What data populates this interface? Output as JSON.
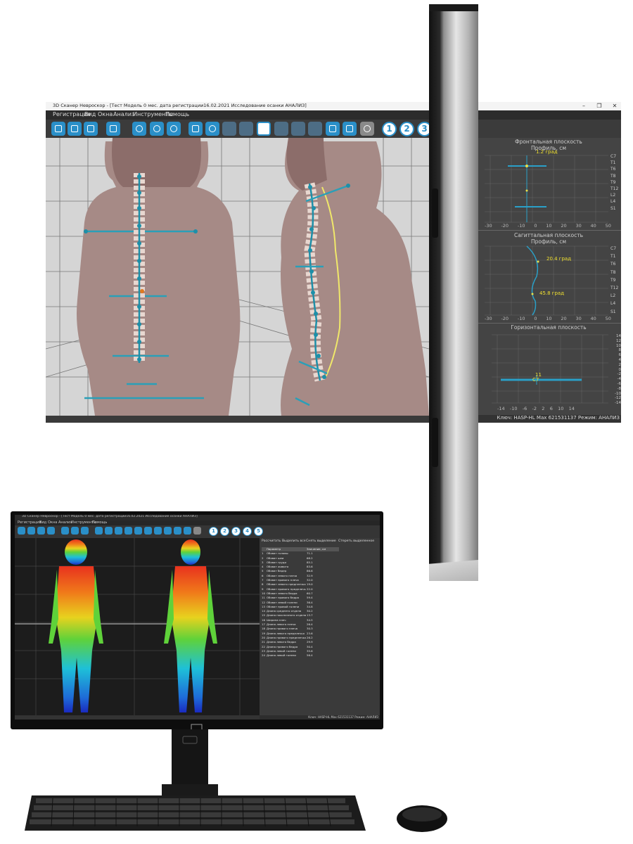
{
  "app": {
    "title": "3D Сканер Невроскор - [Тест Модель 0 мес. дата регистрации16.02.2021 Исследование осанки АНАЛИЗ]",
    "window_controls": [
      "–",
      "❐",
      "✕"
    ]
  },
  "menu": [
    "Регистрация",
    "Вид",
    "Окна",
    "Анализ",
    "Инструменты",
    "Помощь"
  ],
  "toolbar": {
    "numbers": [
      "1",
      "2",
      "3"
    ],
    "icons": [
      "new-icon",
      "open-icon",
      "save-icon",
      "print-icon",
      "copy-icon",
      "settings-icon",
      "zoom-icon",
      "compare-icon",
      "grid-icon",
      "figure-icon",
      "axis-icon",
      "table-icon",
      "spine-icon",
      "hat-icon",
      "ellipse-icon",
      "line-icon",
      "crop-icon",
      "layout-icon",
      "camera-icon"
    ]
  },
  "panels": {
    "frontal": {
      "title": "Фронтальная плоскость",
      "subtitle": "Профиль, см",
      "angle": "1.2 град",
      "vertebrae": [
        "C7",
        "T1",
        "T6",
        "T8",
        "T9",
        "T12",
        "L2",
        "L4",
        "S1"
      ],
      "x_ticks": [
        "-30",
        "-20",
        "-10",
        "0",
        "10",
        "20",
        "30",
        "40",
        "50"
      ]
    },
    "sagittal": {
      "title": "Сагиттальная плоскость",
      "subtitle": "Профиль, см",
      "angle1": "20.4 град",
      "angle2": "45.8 град",
      "vertebrae": [
        "C7",
        "T1",
        "T6",
        "T8",
        "T9",
        "T12",
        "L2",
        "L4",
        "S1"
      ],
      "x_ticks": [
        "-30",
        "-20",
        "-10",
        "0",
        "10",
        "20",
        "30",
        "40",
        "50"
      ]
    },
    "horizontal": {
      "title": "Горизонтальная плоскость",
      "y_ticks": [
        "14",
        "12",
        "10",
        "8",
        "6",
        "4",
        "2",
        "0",
        "-2",
        "-4",
        "-6",
        "-8",
        "-10",
        "-12",
        "-14"
      ],
      "x_ticks": [
        "-14",
        "-10",
        "-6",
        "-2",
        "2",
        "6",
        "10",
        "14"
      ],
      "label1": "11",
      "label2": "C7"
    }
  },
  "status": "Ключ: HASP-HL Max 621531137 Режим: АНАЛИЗ",
  "monitor2": {
    "title": "3D Сканер Невроскор - [Тест Модель 0 мес. дата регистрации16.02.2021 Исследование осанки АНАЛИЗ]",
    "menu": [
      "Регистрация",
      "Вид",
      "Окна",
      "Анализ",
      "Инструменты",
      "Помощь"
    ],
    "toolbar_numbers": [
      "1",
      "2",
      "3",
      "4",
      "5"
    ],
    "buttons": [
      "Рассчитать",
      "Выделить все",
      "Снять выделение",
      "Стереть выделенное"
    ],
    "table": {
      "headers": [
        "",
        "Параметр",
        "Значение, см"
      ],
      "rows": [
        [
          "1",
          "Обхват головы",
          "71.1"
        ],
        [
          "2",
          "Обхват шеи",
          "68.2"
        ],
        [
          "3",
          "Обхват груди",
          "85.1"
        ],
        [
          "4",
          "Обхват живота",
          "83.6"
        ],
        [
          "5",
          "Обхват бедер",
          "86.6"
        ],
        [
          "6",
          "Обхват левого плеча",
          "32.9"
        ],
        [
          "7",
          "Обхват правого плеча",
          "32.0"
        ],
        [
          "8",
          "Обхват левого предплечья",
          "19.0"
        ],
        [
          "9",
          "Обхват правого предплечья",
          "22.0"
        ],
        [
          "10",
          "Обхват левого бедра",
          "60.7"
        ],
        [
          "11",
          "Обхват правого бедра",
          "59.4"
        ],
        [
          "12",
          "Обхват левой голени",
          "36.4"
        ],
        [
          "13",
          "Обхват правой голени",
          "34.8"
        ],
        [
          "14",
          "Длина среднего отдела",
          "30.2"
        ],
        [
          "15",
          "Длина поясничного отдела",
          "13.7"
        ],
        [
          "16",
          "Ширина плеч",
          "34.5"
        ],
        [
          "17",
          "Длина левого плеча",
          "26.4"
        ],
        [
          "18",
          "Длина правого плеча",
          "30.3"
        ],
        [
          "19",
          "Длина левого предплечья",
          "23.6"
        ],
        [
          "20",
          "Длина правого предплечья",
          "26.2"
        ],
        [
          "21",
          "Длина левого бедра",
          "29.9"
        ],
        [
          "22",
          "Длина правого бедра",
          "30.4"
        ],
        [
          "23",
          "Длина левой голени",
          "35.6"
        ],
        [
          "24",
          "Длина левой голени",
          "56.4"
        ]
      ]
    },
    "status": "Ключ: HASP-HL Max 621531137 Режим: АНАЛИЗ"
  }
}
